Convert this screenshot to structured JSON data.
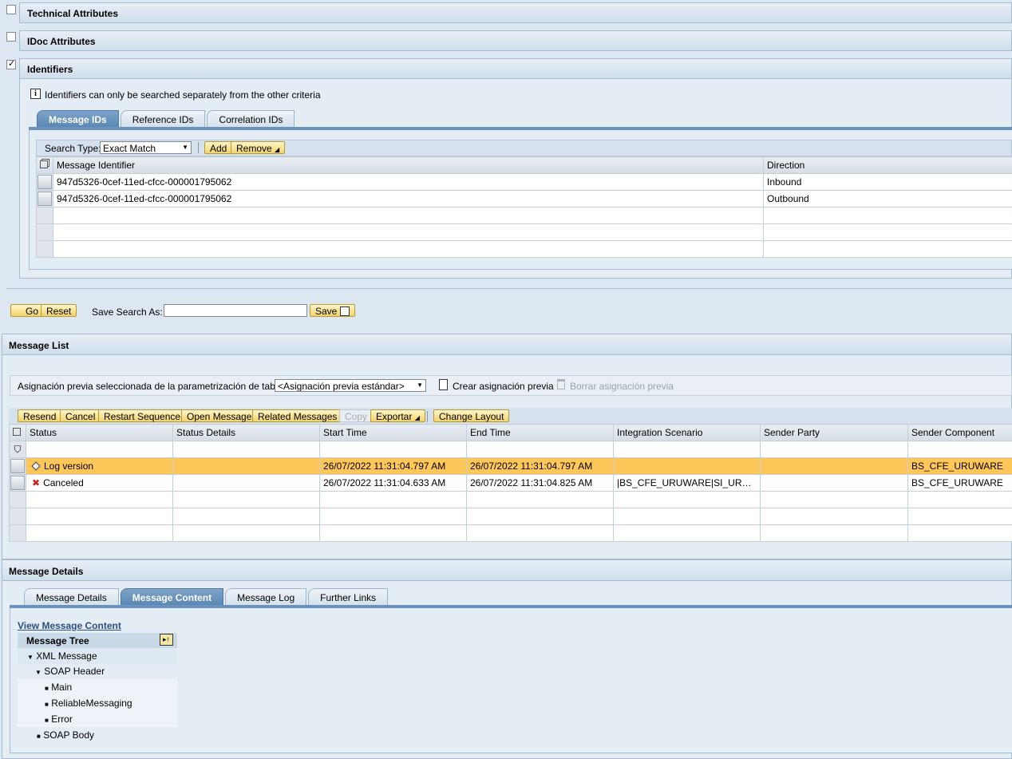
{
  "criteria_panels": [
    {
      "label": "Technical Attributes",
      "checked": false
    },
    {
      "label": "IDoc Attributes",
      "checked": false
    },
    {
      "label": "Identifiers",
      "checked": true
    }
  ],
  "identifiers": {
    "info_text": "Identifiers can only be searched separately from the other criteria",
    "tabs": [
      "Message IDs",
      "Reference IDs",
      "Correlation IDs"
    ],
    "search_type_label": "Search Type:",
    "search_type_value": "Exact Match",
    "add_label": "Add",
    "remove_label": "Remove",
    "columns": [
      "Message Identifier",
      "Direction"
    ],
    "rows": [
      {
        "id": "947d5326-0cef-11ed-cfcc-000001795062",
        "direction": "Inbound"
      },
      {
        "id": "947d5326-0cef-11ed-cfcc-000001795062",
        "direction": "Outbound"
      }
    ]
  },
  "search_bar": {
    "go_label": "Go",
    "reset_label": "Reset",
    "save_search_label": "Save Search As:",
    "save_search_value": "",
    "save_label": "Save"
  },
  "message_list": {
    "title": "Message List",
    "layout_label": "Asignación previa seleccionada de la parametrización de tablas:",
    "layout_value": "<Asignación previa estándar>",
    "create_layout": "Crear asignación previa",
    "delete_layout": "Borrar asignación previa",
    "toolbar": {
      "resend": "Resend",
      "cancel": "Cancel",
      "restart": "Restart Sequence",
      "open": "Open Message",
      "related": "Related Messages",
      "copy": "Copy",
      "export": "Exportar",
      "change_layout": "Change Layout"
    },
    "columns": [
      "Status",
      "Status Details",
      "Start Time",
      "End Time",
      "Integration Scenario",
      "Sender Party",
      "Sender Component"
    ],
    "rows": [
      {
        "status": "Log version",
        "status_icon": "diamond-icon",
        "details": "",
        "start": "26/07/2022 11:31:04.797 AM",
        "end": "26/07/2022 11:31:04.797 AM",
        "scenario": "",
        "party": "",
        "component": "BS_CFE_URUWARE",
        "highlighted": true
      },
      {
        "status": "Canceled",
        "status_icon": "red-x-icon",
        "details": "",
        "start": "26/07/2022 11:31:04.633 AM",
        "end": "26/07/2022 11:31:04.825 AM",
        "scenario": "|BS_CFE_URUWARE|SI_URU…",
        "party": "",
        "component": "BS_CFE_URUWARE",
        "highlighted": false
      }
    ]
  },
  "message_details": {
    "title": "Message Details",
    "tabs": [
      "Message Details",
      "Message Content",
      "Message Log",
      "Further Links"
    ],
    "active_tab": "Message Content",
    "view_link": "View Message Content",
    "tree_title": "Message Tree",
    "tree": {
      "root": "XML Message",
      "header": "SOAP Header",
      "header_children": [
        "Main",
        "ReliableMessaging",
        "Error"
      ],
      "body": "SOAP Body"
    }
  },
  "colors": {
    "highlight_row": "#ffc75a",
    "tab_active": "#5a88b5",
    "button": "#f2d36a"
  }
}
